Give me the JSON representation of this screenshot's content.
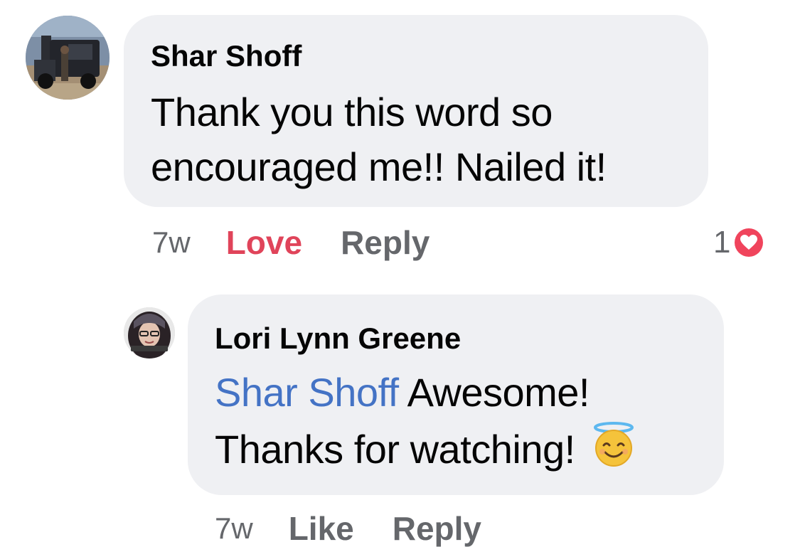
{
  "comments": [
    {
      "author": "Shar Shoff",
      "text": "Thank you this word so encouraged me!! Nailed it!",
      "timestamp": "7w",
      "reaction_label": "Love",
      "reply_label": "Reply",
      "reaction_count": "1",
      "reaction_icon": "heart-icon"
    }
  ],
  "reply": {
    "author": "Lori Lynn Greene",
    "mention": "Shar Shoff",
    "text_line1": "Awesome!",
    "text_line2": "Thanks for watching!",
    "emoji": "smiling-face-with-halo-icon",
    "timestamp": "7w",
    "like_label": "Like",
    "reply_label": "Reply"
  },
  "colors": {
    "bubble": "#eff0f3",
    "meta_gray": "#65676b",
    "love_red": "#e0445a",
    "mention_blue": "#4473c5"
  }
}
